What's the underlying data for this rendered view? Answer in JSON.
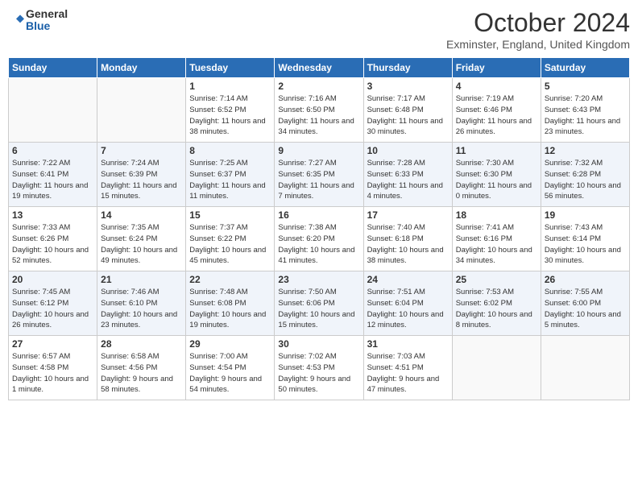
{
  "header": {
    "logo_general": "General",
    "logo_blue": "Blue",
    "title": "October 2024",
    "location": "Exminster, England, United Kingdom"
  },
  "days_of_week": [
    "Sunday",
    "Monday",
    "Tuesday",
    "Wednesday",
    "Thursday",
    "Friday",
    "Saturday"
  ],
  "weeks": [
    [
      {
        "day": "",
        "info": ""
      },
      {
        "day": "",
        "info": ""
      },
      {
        "day": "1",
        "info": "Sunrise: 7:14 AM\nSunset: 6:52 PM\nDaylight: 11 hours and 38 minutes."
      },
      {
        "day": "2",
        "info": "Sunrise: 7:16 AM\nSunset: 6:50 PM\nDaylight: 11 hours and 34 minutes."
      },
      {
        "day": "3",
        "info": "Sunrise: 7:17 AM\nSunset: 6:48 PM\nDaylight: 11 hours and 30 minutes."
      },
      {
        "day": "4",
        "info": "Sunrise: 7:19 AM\nSunset: 6:46 PM\nDaylight: 11 hours and 26 minutes."
      },
      {
        "day": "5",
        "info": "Sunrise: 7:20 AM\nSunset: 6:43 PM\nDaylight: 11 hours and 23 minutes."
      }
    ],
    [
      {
        "day": "6",
        "info": "Sunrise: 7:22 AM\nSunset: 6:41 PM\nDaylight: 11 hours and 19 minutes."
      },
      {
        "day": "7",
        "info": "Sunrise: 7:24 AM\nSunset: 6:39 PM\nDaylight: 11 hours and 15 minutes."
      },
      {
        "day": "8",
        "info": "Sunrise: 7:25 AM\nSunset: 6:37 PM\nDaylight: 11 hours and 11 minutes."
      },
      {
        "day": "9",
        "info": "Sunrise: 7:27 AM\nSunset: 6:35 PM\nDaylight: 11 hours and 7 minutes."
      },
      {
        "day": "10",
        "info": "Sunrise: 7:28 AM\nSunset: 6:33 PM\nDaylight: 11 hours and 4 minutes."
      },
      {
        "day": "11",
        "info": "Sunrise: 7:30 AM\nSunset: 6:30 PM\nDaylight: 11 hours and 0 minutes."
      },
      {
        "day": "12",
        "info": "Sunrise: 7:32 AM\nSunset: 6:28 PM\nDaylight: 10 hours and 56 minutes."
      }
    ],
    [
      {
        "day": "13",
        "info": "Sunrise: 7:33 AM\nSunset: 6:26 PM\nDaylight: 10 hours and 52 minutes."
      },
      {
        "day": "14",
        "info": "Sunrise: 7:35 AM\nSunset: 6:24 PM\nDaylight: 10 hours and 49 minutes."
      },
      {
        "day": "15",
        "info": "Sunrise: 7:37 AM\nSunset: 6:22 PM\nDaylight: 10 hours and 45 minutes."
      },
      {
        "day": "16",
        "info": "Sunrise: 7:38 AM\nSunset: 6:20 PM\nDaylight: 10 hours and 41 minutes."
      },
      {
        "day": "17",
        "info": "Sunrise: 7:40 AM\nSunset: 6:18 PM\nDaylight: 10 hours and 38 minutes."
      },
      {
        "day": "18",
        "info": "Sunrise: 7:41 AM\nSunset: 6:16 PM\nDaylight: 10 hours and 34 minutes."
      },
      {
        "day": "19",
        "info": "Sunrise: 7:43 AM\nSunset: 6:14 PM\nDaylight: 10 hours and 30 minutes."
      }
    ],
    [
      {
        "day": "20",
        "info": "Sunrise: 7:45 AM\nSunset: 6:12 PM\nDaylight: 10 hours and 26 minutes."
      },
      {
        "day": "21",
        "info": "Sunrise: 7:46 AM\nSunset: 6:10 PM\nDaylight: 10 hours and 23 minutes."
      },
      {
        "day": "22",
        "info": "Sunrise: 7:48 AM\nSunset: 6:08 PM\nDaylight: 10 hours and 19 minutes."
      },
      {
        "day": "23",
        "info": "Sunrise: 7:50 AM\nSunset: 6:06 PM\nDaylight: 10 hours and 15 minutes."
      },
      {
        "day": "24",
        "info": "Sunrise: 7:51 AM\nSunset: 6:04 PM\nDaylight: 10 hours and 12 minutes."
      },
      {
        "day": "25",
        "info": "Sunrise: 7:53 AM\nSunset: 6:02 PM\nDaylight: 10 hours and 8 minutes."
      },
      {
        "day": "26",
        "info": "Sunrise: 7:55 AM\nSunset: 6:00 PM\nDaylight: 10 hours and 5 minutes."
      }
    ],
    [
      {
        "day": "27",
        "info": "Sunrise: 6:57 AM\nSunset: 4:58 PM\nDaylight: 10 hours and 1 minute."
      },
      {
        "day": "28",
        "info": "Sunrise: 6:58 AM\nSunset: 4:56 PM\nDaylight: 9 hours and 58 minutes."
      },
      {
        "day": "29",
        "info": "Sunrise: 7:00 AM\nSunset: 4:54 PM\nDaylight: 9 hours and 54 minutes."
      },
      {
        "day": "30",
        "info": "Sunrise: 7:02 AM\nSunset: 4:53 PM\nDaylight: 9 hours and 50 minutes."
      },
      {
        "day": "31",
        "info": "Sunrise: 7:03 AM\nSunset: 4:51 PM\nDaylight: 9 hours and 47 minutes."
      },
      {
        "day": "",
        "info": ""
      },
      {
        "day": "",
        "info": ""
      }
    ]
  ]
}
